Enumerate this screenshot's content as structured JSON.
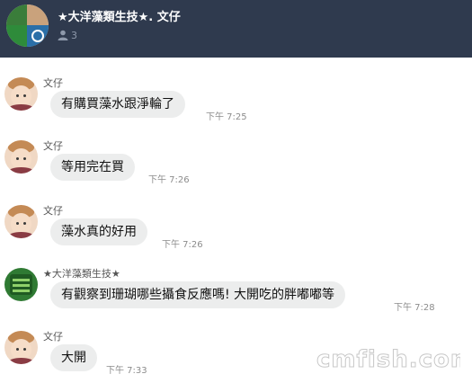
{
  "header": {
    "title": "★大洋藻類生技★. 文仔",
    "member_count": "3"
  },
  "messages": [
    {
      "sender": "文仔",
      "text": "有購買藻水跟淨輪了",
      "time": "下午 7:25",
      "avatar": "baby-avatar"
    },
    {
      "sender": "文仔",
      "text": "等用完在買",
      "time": "下午 7:26",
      "avatar": "baby-avatar"
    },
    {
      "sender": "文仔",
      "text": "藻水真的好用",
      "time": "下午 7:26",
      "avatar": "baby-avatar"
    },
    {
      "sender": "★大洋藻類生技★",
      "text": "有觀察到珊瑚哪些攝食反應嗎! 大開吃的胖嘟嘟等",
      "time": "下午 7:28",
      "avatar": "shop-logo-avatar"
    },
    {
      "sender": "文仔",
      "text": "大開",
      "time": "下午 7:33",
      "avatar": "baby-avatar"
    }
  ],
  "watermark": {
    "text": "cmfish.com"
  }
}
